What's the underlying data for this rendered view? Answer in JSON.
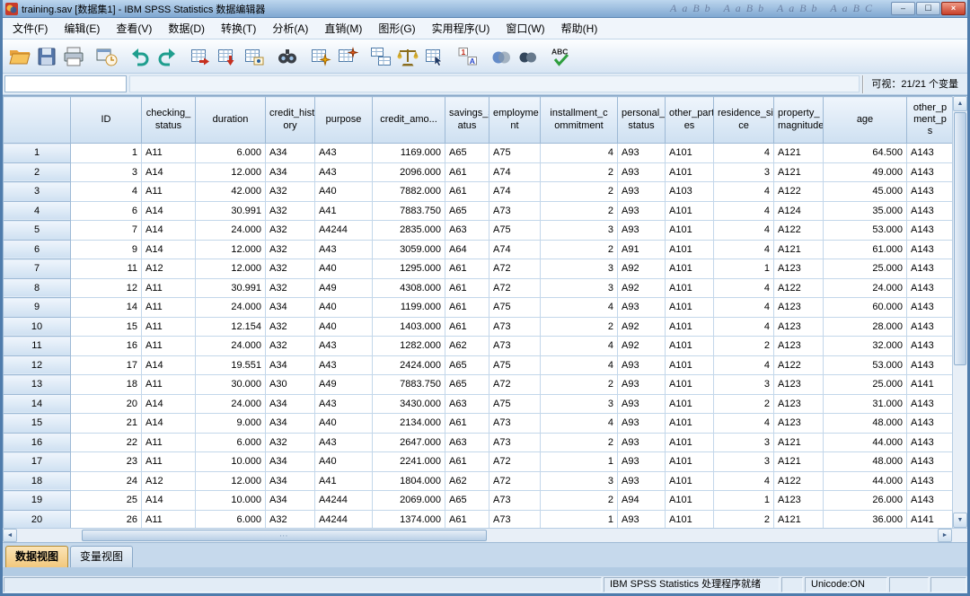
{
  "window": {
    "title": "training.sav [数据集1] - IBM SPSS Statistics 数据编辑器",
    "ghost_text": "AaBb AaBb AaBb AaBC",
    "controls": {
      "minimize": "–",
      "maximize": "☐",
      "close": "×"
    }
  },
  "menu": {
    "items": [
      {
        "name": "file",
        "label": "文件(F)"
      },
      {
        "name": "edit",
        "label": "编辑(E)"
      },
      {
        "name": "view",
        "label": "查看(V)"
      },
      {
        "name": "data",
        "label": "数据(D)"
      },
      {
        "name": "transform",
        "label": "转换(T)"
      },
      {
        "name": "analyze",
        "label": "分析(A)"
      },
      {
        "name": "direct-marketing",
        "label": "直销(M)"
      },
      {
        "name": "graphs",
        "label": "图形(G)"
      },
      {
        "name": "utilities",
        "label": "实用程序(U)"
      },
      {
        "name": "window",
        "label": "窗口(W)"
      },
      {
        "name": "help",
        "label": "帮助(H)"
      }
    ]
  },
  "toolbar": {
    "groups": [
      [
        "open-data-icon",
        "save-icon",
        "print-icon"
      ],
      [
        "recall-dialogs-icon"
      ],
      [
        "undo-icon",
        "redo-icon"
      ],
      [
        "goto-case-icon",
        "goto-variable-icon",
        "variables-icon"
      ],
      [
        "find-icon"
      ],
      [
        "insert-case-icon",
        "insert-variable-icon"
      ],
      [
        "split-file-icon",
        "weight-cases-icon",
        "select-cases-icon"
      ],
      [
        "value-labels-icon"
      ],
      [
        "use-variable-sets-icon",
        "show-all-variables-icon"
      ],
      [
        "spell-check-icon"
      ]
    ]
  },
  "cellbar": {
    "cell_value": "",
    "visible_label": "可视：21/21 个变量"
  },
  "grid": {
    "row_header_width": 75,
    "columns": [
      {
        "key": "id",
        "label": "ID",
        "width": 79,
        "align": "r"
      },
      {
        "key": "checking_status",
        "label": "checking_\nstatus",
        "width": 60,
        "align": "l"
      },
      {
        "key": "duration",
        "label": "duration",
        "width": 78,
        "align": "r"
      },
      {
        "key": "credit_history",
        "label": "credit_hist\nory",
        "width": 55,
        "align": "l"
      },
      {
        "key": "purpose",
        "label": "purpose",
        "width": 64,
        "align": "l"
      },
      {
        "key": "credit_amount",
        "label": "credit_amo...",
        "width": 81,
        "align": "r"
      },
      {
        "key": "savings_status",
        "label": "savings_st\natus",
        "width": 49,
        "align": "l"
      },
      {
        "key": "employment",
        "label": "employme\nnt",
        "width": 57,
        "align": "l"
      },
      {
        "key": "installment_commitment",
        "label": "installment_c\nommitment",
        "width": 86,
        "align": "r"
      },
      {
        "key": "personal_status",
        "label": "personal_\nstatus",
        "width": 53,
        "align": "l"
      },
      {
        "key": "other_parties",
        "label": "other_parti\nes",
        "width": 54,
        "align": "l"
      },
      {
        "key": "residence_since",
        "label": "residence_sin\nce",
        "width": 67,
        "align": "r"
      },
      {
        "key": "property_magnitude",
        "label": "property_\nmagnitude",
        "width": 55,
        "align": "l"
      },
      {
        "key": "age",
        "label": "age",
        "width": 93,
        "align": "r"
      },
      {
        "key": "other_payment_plans",
        "label": "other_p\nment_p\ns",
        "width": 52,
        "align": "l"
      }
    ],
    "rows": [
      {
        "num": "1",
        "cells": [
          "1",
          "A11",
          "6.000",
          "A34",
          "A43",
          "1169.000",
          "A65",
          "A75",
          "4",
          "A93",
          "A101",
          "4",
          "A121",
          "64.500",
          "A143"
        ]
      },
      {
        "num": "2",
        "cells": [
          "3",
          "A14",
          "12.000",
          "A34",
          "A43",
          "2096.000",
          "A61",
          "A74",
          "2",
          "A93",
          "A101",
          "3",
          "A121",
          "49.000",
          "A143"
        ]
      },
      {
        "num": "3",
        "cells": [
          "4",
          "A11",
          "42.000",
          "A32",
          "A40",
          "7882.000",
          "A61",
          "A74",
          "2",
          "A93",
          "A103",
          "4",
          "A122",
          "45.000",
          "A143"
        ]
      },
      {
        "num": "4",
        "cells": [
          "6",
          "A14",
          "30.991",
          "A32",
          "A41",
          "7883.750",
          "A65",
          "A73",
          "2",
          "A93",
          "A101",
          "4",
          "A124",
          "35.000",
          "A143"
        ]
      },
      {
        "num": "5",
        "cells": [
          "7",
          "A14",
          "24.000",
          "A32",
          "A4244",
          "2835.000",
          "A63",
          "A75",
          "3",
          "A93",
          "A101",
          "4",
          "A122",
          "53.000",
          "A143"
        ]
      },
      {
        "num": "6",
        "cells": [
          "9",
          "A14",
          "12.000",
          "A32",
          "A43",
          "3059.000",
          "A64",
          "A74",
          "2",
          "A91",
          "A101",
          "4",
          "A121",
          "61.000",
          "A143"
        ]
      },
      {
        "num": "7",
        "cells": [
          "11",
          "A12",
          "12.000",
          "A32",
          "A40",
          "1295.000",
          "A61",
          "A72",
          "3",
          "A92",
          "A101",
          "1",
          "A123",
          "25.000",
          "A143"
        ]
      },
      {
        "num": "8",
        "cells": [
          "12",
          "A11",
          "30.991",
          "A32",
          "A49",
          "4308.000",
          "A61",
          "A72",
          "3",
          "A92",
          "A101",
          "4",
          "A122",
          "24.000",
          "A143"
        ]
      },
      {
        "num": "9",
        "cells": [
          "14",
          "A11",
          "24.000",
          "A34",
          "A40",
          "1199.000",
          "A61",
          "A75",
          "4",
          "A93",
          "A101",
          "4",
          "A123",
          "60.000",
          "A143"
        ]
      },
      {
        "num": "10",
        "cells": [
          "15",
          "A11",
          "12.154",
          "A32",
          "A40",
          "1403.000",
          "A61",
          "A73",
          "2",
          "A92",
          "A101",
          "4",
          "A123",
          "28.000",
          "A143"
        ]
      },
      {
        "num": "11",
        "cells": [
          "16",
          "A11",
          "24.000",
          "A32",
          "A43",
          "1282.000",
          "A62",
          "A73",
          "4",
          "A92",
          "A101",
          "2",
          "A123",
          "32.000",
          "A143"
        ]
      },
      {
        "num": "12",
        "cells": [
          "17",
          "A14",
          "19.551",
          "A34",
          "A43",
          "2424.000",
          "A65",
          "A75",
          "4",
          "A93",
          "A101",
          "4",
          "A122",
          "53.000",
          "A143"
        ]
      },
      {
        "num": "13",
        "cells": [
          "18",
          "A11",
          "30.000",
          "A30",
          "A49",
          "7883.750",
          "A65",
          "A72",
          "2",
          "A93",
          "A101",
          "3",
          "A123",
          "25.000",
          "A141"
        ]
      },
      {
        "num": "14",
        "cells": [
          "20",
          "A14",
          "24.000",
          "A34",
          "A43",
          "3430.000",
          "A63",
          "A75",
          "3",
          "A93",
          "A101",
          "2",
          "A123",
          "31.000",
          "A143"
        ]
      },
      {
        "num": "15",
        "cells": [
          "21",
          "A14",
          "9.000",
          "A34",
          "A40",
          "2134.000",
          "A61",
          "A73",
          "4",
          "A93",
          "A101",
          "4",
          "A123",
          "48.000",
          "A143"
        ]
      },
      {
        "num": "16",
        "cells": [
          "22",
          "A11",
          "6.000",
          "A32",
          "A43",
          "2647.000",
          "A63",
          "A73",
          "2",
          "A93",
          "A101",
          "3",
          "A121",
          "44.000",
          "A143"
        ]
      },
      {
        "num": "17",
        "cells": [
          "23",
          "A11",
          "10.000",
          "A34",
          "A40",
          "2241.000",
          "A61",
          "A72",
          "1",
          "A93",
          "A101",
          "3",
          "A121",
          "48.000",
          "A143"
        ]
      },
      {
        "num": "18",
        "cells": [
          "24",
          "A12",
          "12.000",
          "A34",
          "A41",
          "1804.000",
          "A62",
          "A72",
          "3",
          "A93",
          "A101",
          "4",
          "A122",
          "44.000",
          "A143"
        ]
      },
      {
        "num": "19",
        "cells": [
          "25",
          "A14",
          "10.000",
          "A34",
          "A4244",
          "2069.000",
          "A65",
          "A73",
          "2",
          "A94",
          "A101",
          "1",
          "A123",
          "26.000",
          "A143"
        ]
      },
      {
        "num": "20",
        "cells": [
          "26",
          "A11",
          "6.000",
          "A32",
          "A4244",
          "1374.000",
          "A61",
          "A73",
          "1",
          "A93",
          "A101",
          "2",
          "A121",
          "36.000",
          "A141"
        ]
      }
    ]
  },
  "tabs": [
    {
      "name": "data-view",
      "label": "数据视图",
      "active": true
    },
    {
      "name": "variable-view",
      "label": "变量视图",
      "active": false
    }
  ],
  "statusbar": {
    "ready_text": "IBM SPSS Statistics 处理程序就绪",
    "unicode_text": "Unicode:ON"
  },
  "scrollbar_glyphs": {
    "up": "▲",
    "down": "▼",
    "left": "◄",
    "right": "►",
    "grip": "∙∙∙"
  }
}
